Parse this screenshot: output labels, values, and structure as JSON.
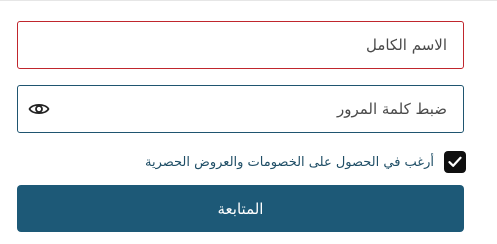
{
  "form": {
    "full_name": {
      "placeholder": "الاسم الكامل",
      "value": ""
    },
    "password": {
      "placeholder": "ضبط كلمة المرور",
      "value": "",
      "toggle_icon": "eye-icon"
    },
    "offers_opt_in": {
      "label": "أرغب في الحصول على الخصومات والعروض الحصرية",
      "checked": true,
      "icon": "checkmark-icon"
    },
    "submit": {
      "label": "المتابعة"
    }
  },
  "colors": {
    "error_border": "#c0262d",
    "focus_border": "#1f5570",
    "button_bg": "#1d5977",
    "label_text": "#1f4e66",
    "checkbox_bg": "#0f0f0f"
  }
}
